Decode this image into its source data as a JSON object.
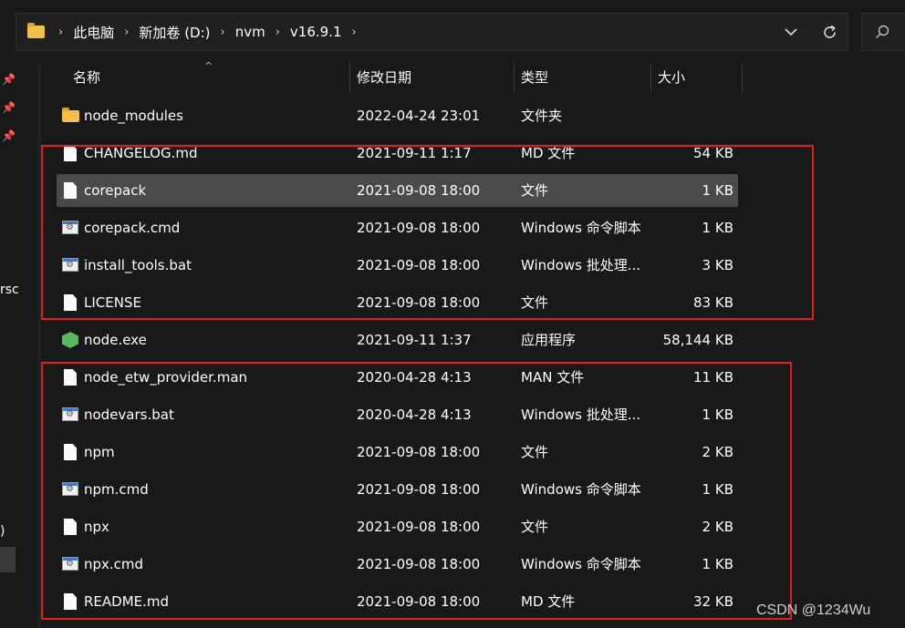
{
  "breadcrumb": [
    "此电脑",
    "新加卷 (D:)",
    "nvm",
    "v16.9.1"
  ],
  "address_buttons": {
    "dropdown_icon": "chevron-down-icon",
    "refresh_icon": "refresh-icon",
    "search_icon": "search-icon"
  },
  "navpane": {
    "fragment_1": "rsc",
    "fragment_2": ")"
  },
  "columns": {
    "name": "名称",
    "date": "修改日期",
    "type": "类型",
    "size": "大小"
  },
  "files": [
    {
      "name": "node_modules",
      "date": "2022-04-24 23:01",
      "type": "文件夹",
      "size": "",
      "icon": "folder-icon"
    },
    {
      "name": "CHANGELOG.md",
      "date": "2021-09-11 1:17",
      "type": "MD 文件",
      "size": "54 KB",
      "icon": "file-icon"
    },
    {
      "name": "corepack",
      "date": "2021-09-08 18:00",
      "type": "文件",
      "size": "1 KB",
      "icon": "file-icon",
      "selected": true
    },
    {
      "name": "corepack.cmd",
      "date": "2021-09-08 18:00",
      "type": "Windows 命令脚本",
      "size": "1 KB",
      "icon": "batch-file-icon"
    },
    {
      "name": "install_tools.bat",
      "date": "2021-09-08 18:00",
      "type": "Windows 批处理...",
      "size": "3 KB",
      "icon": "batch-file-icon"
    },
    {
      "name": "LICENSE",
      "date": "2021-09-08 18:00",
      "type": "文件",
      "size": "83 KB",
      "icon": "file-icon"
    },
    {
      "name": "node.exe",
      "date": "2021-09-11 1:37",
      "type": "应用程序",
      "size": "58,144 KB",
      "icon": "node-exe-icon"
    },
    {
      "name": "node_etw_provider.man",
      "date": "2020-04-28 4:13",
      "type": "MAN 文件",
      "size": "11 KB",
      "icon": "file-icon"
    },
    {
      "name": "nodevars.bat",
      "date": "2020-04-28 4:13",
      "type": "Windows 批处理...",
      "size": "1 KB",
      "icon": "batch-file-icon"
    },
    {
      "name": "npm",
      "date": "2021-09-08 18:00",
      "type": "文件",
      "size": "2 KB",
      "icon": "file-icon"
    },
    {
      "name": "npm.cmd",
      "date": "2021-09-08 18:00",
      "type": "Windows 命令脚本",
      "size": "1 KB",
      "icon": "batch-file-icon"
    },
    {
      "name": "npx",
      "date": "2021-09-08 18:00",
      "type": "文件",
      "size": "2 KB",
      "icon": "file-icon"
    },
    {
      "name": "npx.cmd",
      "date": "2021-09-08 18:00",
      "type": "Windows 命令脚本",
      "size": "1 KB",
      "icon": "batch-file-icon"
    },
    {
      "name": "README.md",
      "date": "2021-09-08 18:00",
      "type": "MD 文件",
      "size": "32 KB",
      "icon": "file-icon"
    }
  ],
  "annotations": {
    "highlight_color": "#e01e1e"
  },
  "watermark": "CSDN @1234Wu"
}
